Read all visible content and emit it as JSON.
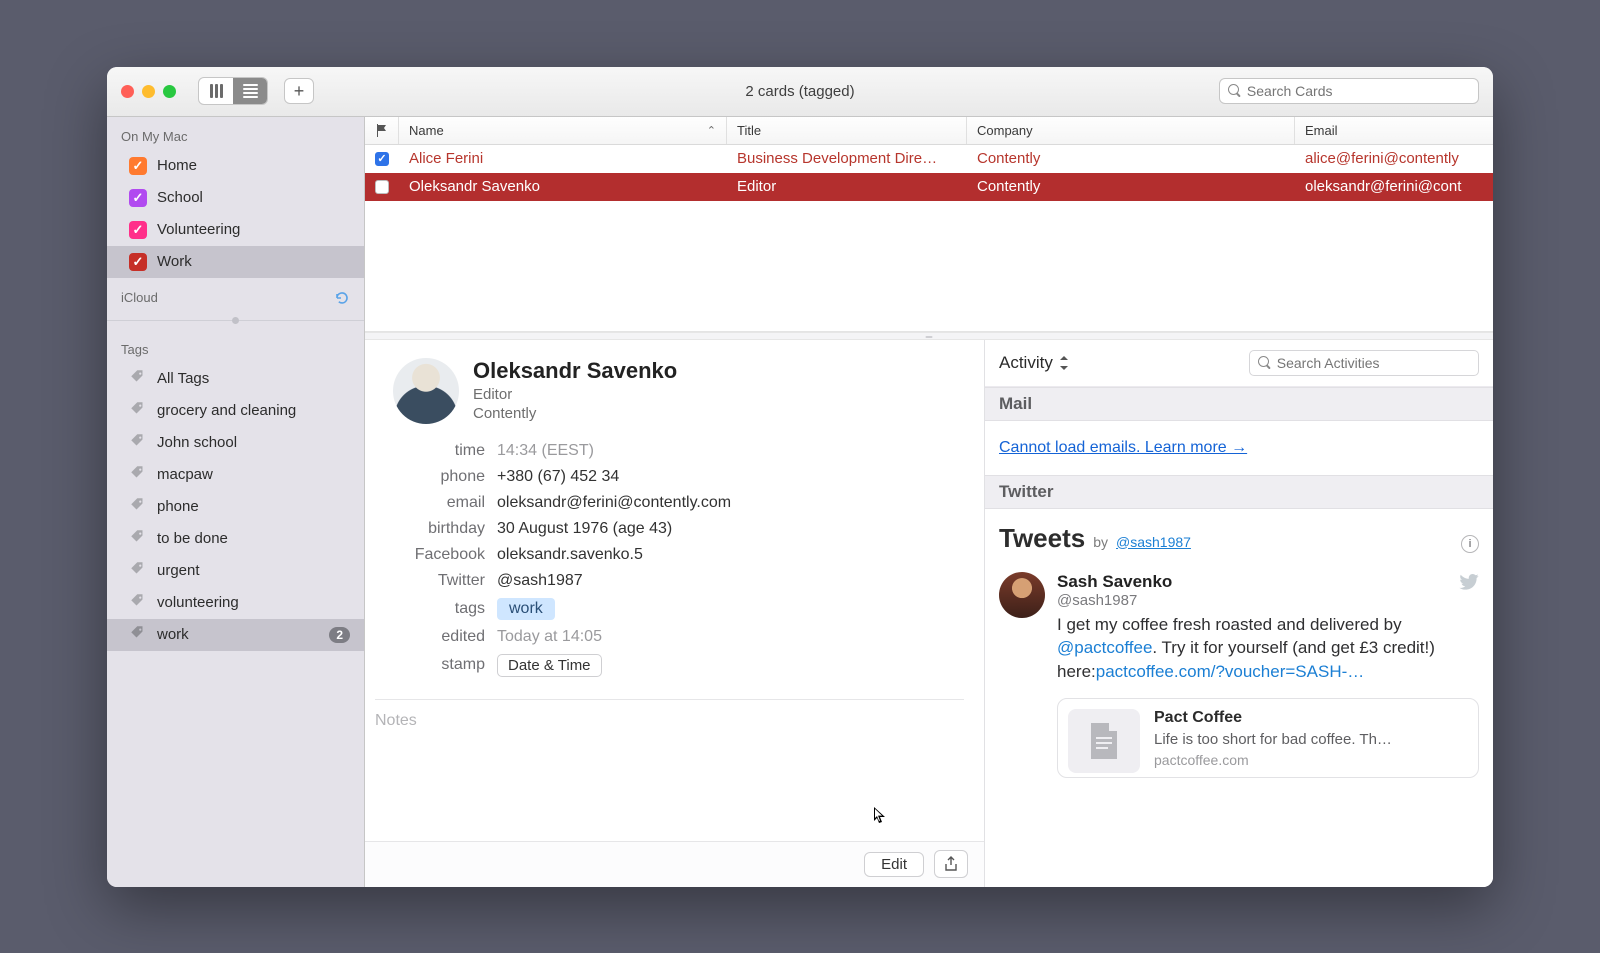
{
  "window": {
    "title": "2 cards (tagged)"
  },
  "toolbar": {
    "search_placeholder": "Search Cards"
  },
  "sidebar": {
    "sections": [
      {
        "label": "On My Mac",
        "items": [
          {
            "label": "Home",
            "color": "#ff7a2f",
            "checked": true
          },
          {
            "label": "School",
            "color": "#b14af0",
            "checked": true
          },
          {
            "label": "Volunteering",
            "color": "#ff2f8a",
            "checked": true
          },
          {
            "label": "Work",
            "color": "#c62f27",
            "checked": true,
            "selected": true
          }
        ]
      },
      {
        "label": "iCloud",
        "refresh": true,
        "items": []
      }
    ],
    "tags_header": "Tags",
    "tags": [
      {
        "label": "All Tags"
      },
      {
        "label": "grocery and cleaning"
      },
      {
        "label": "John school"
      },
      {
        "label": "macpaw"
      },
      {
        "label": "phone"
      },
      {
        "label": "to be done"
      },
      {
        "label": "urgent"
      },
      {
        "label": "volunteering"
      },
      {
        "label": "work",
        "count": "2",
        "selected": true
      }
    ]
  },
  "table": {
    "columns": {
      "flag": "",
      "name": "Name",
      "title": "Title",
      "company": "Company",
      "email": "Email"
    },
    "rows": [
      {
        "flagged": true,
        "name": "Alice Ferini",
        "title": "Business Development Dire…",
        "company": "Contently",
        "email": "alice@ferini@contently"
      },
      {
        "flagged": false,
        "name": "Oleksandr Savenko",
        "title": "Editor",
        "company": "Contently",
        "email": "oleksandr@ferini@cont",
        "selected": true
      }
    ]
  },
  "card": {
    "name": "Oleksandr Savenko",
    "title": "Editor",
    "company": "Contently",
    "fields": {
      "time": {
        "label": "time",
        "value": "14:34 (EEST)",
        "muted": true
      },
      "phone": {
        "label": "phone",
        "value": "+380 (67) 452 34"
      },
      "email": {
        "label": "email",
        "value": "oleksandr@ferini@contently.com"
      },
      "birthday": {
        "label": "birthday",
        "value": "30 August 1976 (age 43)"
      },
      "facebook": {
        "label": "Facebook",
        "value": "oleksandr.savenko.5"
      },
      "twitter": {
        "label": "Twitter",
        "value": "@sash1987"
      },
      "tags": {
        "label": "tags",
        "value": "work"
      },
      "edited": {
        "label": "edited",
        "value": "Today at 14:05",
        "muted": true
      },
      "stamp": {
        "label": "stamp",
        "value": "Date & Time"
      }
    },
    "notes_placeholder": "Notes",
    "edit_button": "Edit"
  },
  "activity": {
    "heading": "Activity",
    "search_placeholder": "Search Activities",
    "mail": {
      "header": "Mail",
      "error": "Cannot load emails. Learn more →"
    },
    "twitter": {
      "header": "Twitter",
      "tweets_label": "Tweets",
      "by_label": "by",
      "handle": "@sash1987",
      "tweet": {
        "author": "Sash Savenko",
        "author_handle": "@sash1987",
        "text_1": "I get my coffee fresh roasted and delivered by ",
        "mention": "@pactcoffee",
        "text_2": ". Try it for yourself (and get £3 credit!) here:",
        "link": "pactcoffee.com/?voucher=SASH-…",
        "card": {
          "title": "Pact Coffee",
          "desc": "Life is too short for bad coffee. Th…",
          "url": "pactcoffee.com"
        }
      }
    }
  }
}
